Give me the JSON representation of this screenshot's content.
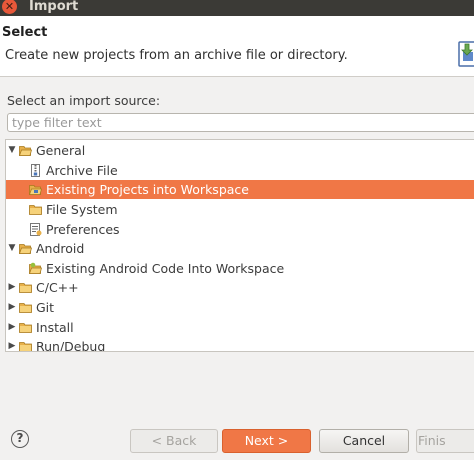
{
  "window": {
    "title": "Import"
  },
  "header": {
    "title": "Select",
    "description": "Create new projects from an archive file or directory."
  },
  "source": {
    "label": "Select an import source:",
    "filter_placeholder": "type filter text"
  },
  "tree": [
    {
      "label": "General",
      "kind": "folder",
      "expanded": true
    },
    {
      "label": "Archive File",
      "kind": "archive"
    },
    {
      "label": "Existing Projects into Workspace",
      "kind": "projects",
      "selected": true
    },
    {
      "label": "File System",
      "kind": "folder"
    },
    {
      "label": "Preferences",
      "kind": "prefs"
    },
    {
      "label": "Android",
      "kind": "folder",
      "expanded": true
    },
    {
      "label": "Existing Android Code Into Workspace",
      "kind": "android"
    },
    {
      "label": "C/C++",
      "kind": "folder",
      "expanded": false
    },
    {
      "label": "Git",
      "kind": "folder",
      "expanded": false
    },
    {
      "label": "Install",
      "kind": "folder",
      "expanded": false
    },
    {
      "label": "Run/Debug",
      "kind": "folder",
      "expanded": false
    }
  ],
  "buttons": {
    "back": "< Back",
    "next": "Next >",
    "cancel": "Cancel",
    "finish": "Finis"
  },
  "colors": {
    "accent": "#f07746",
    "titlebar": "#3b3a36",
    "folder": "#e7b04a"
  }
}
